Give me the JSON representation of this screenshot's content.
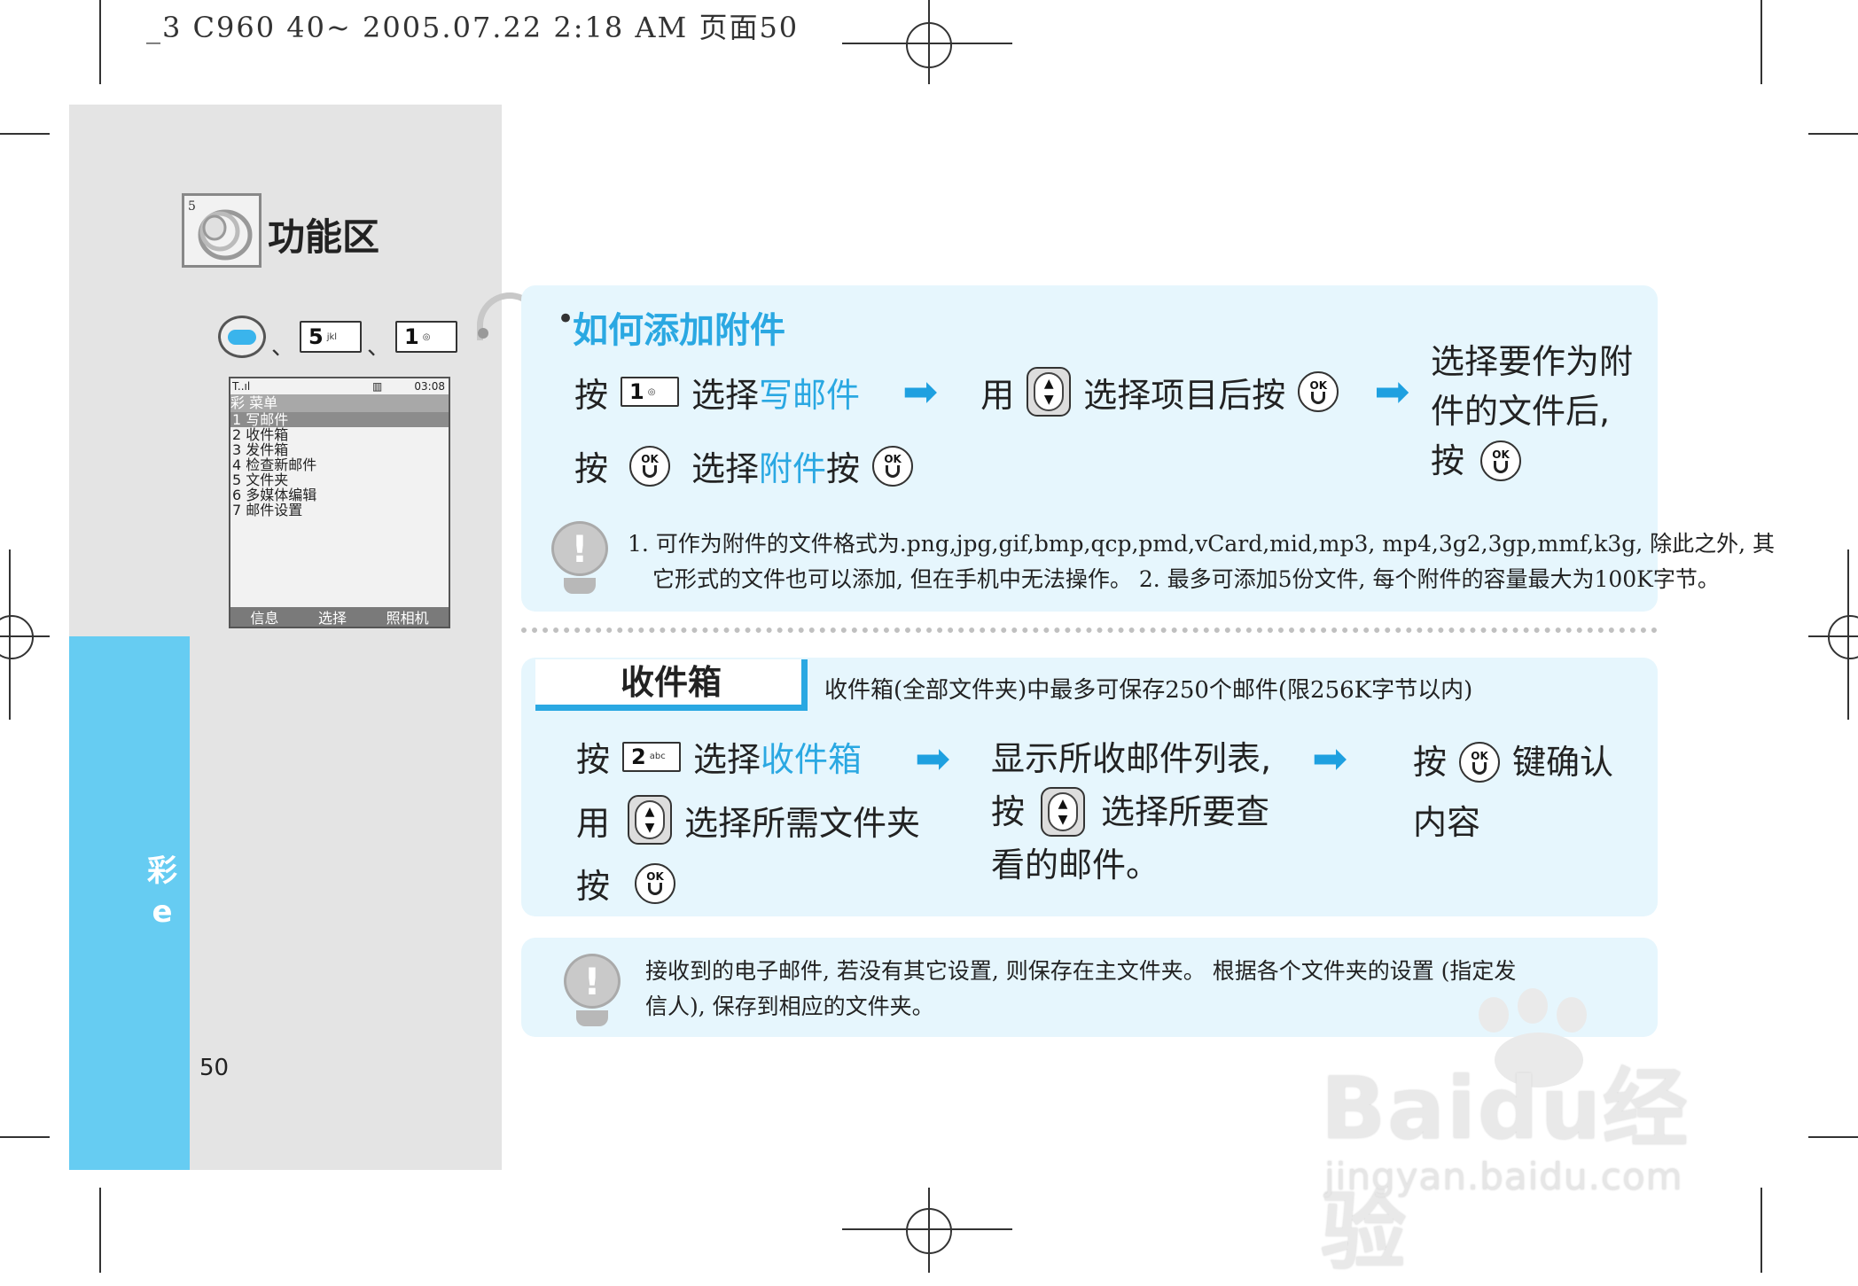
{
  "print_header": "_3 C960 40~ 2005.07.22 2:18 AM 页面50",
  "section": {
    "title": "功能区",
    "side_label": "彩",
    "side_sub": "e",
    "page_number": "50"
  },
  "key_path": {
    "key1_num": "5",
    "key1_letters": "jkl",
    "key2_num": "1",
    "separator": "、"
  },
  "phone_screen": {
    "status_left": "T..ıl",
    "status_right": "03:08",
    "menu_title": "彩 菜单",
    "items": [
      "1 写邮件",
      "2 收件箱",
      "3 发件箱",
      "4 检查新邮件",
      "5 文件夹",
      "6 多媒体编辑",
      "7 邮件设置"
    ],
    "soft_keys": [
      "信息",
      "选择",
      "照相机"
    ]
  },
  "attach": {
    "bullet": "•",
    "title": "如何添加附件",
    "row1": {
      "press": "按",
      "key_num": "1",
      "select": "选择",
      "highlight": "写邮件",
      "use": "用",
      "select_item": "选择项目后按"
    },
    "row2": {
      "press": "按",
      "select": "选择",
      "highlight": "附件",
      "press2": "按"
    },
    "right": {
      "line1": "选择要作为附",
      "line2": "件的文件后,",
      "press": "按"
    },
    "note_line1": "1. 可作为附件的文件格式为.png,jpg,gif,bmp,qcp,pmd,vCard,mid,mp3, mp4,3g2,3gp,mmf,k3g, 除此之外, 其",
    "note_line2": "它形式的文件也可以添加, 但在手机中无法操作。 2. 最多可添加5份文件, 每个附件的容量最大为100K字节。"
  },
  "inbox": {
    "title": "收件箱",
    "subtitle": "收件箱(全部文件夹)中最多可保存250个邮件(限256K字节以内)",
    "col1": {
      "press": "按",
      "key_num": "2",
      "key_letters": "abc",
      "select": "选择",
      "highlight": "收件箱",
      "use": "用",
      "select_folder": "选择所需文件夹",
      "press2": "按"
    },
    "col2": {
      "line1": "显示所收邮件列表,",
      "press": "按",
      "select": "选择所要查",
      "line3": "看的邮件。"
    },
    "col3": {
      "press": "按",
      "confirm": "键确认",
      "line2": "内容"
    }
  },
  "bottom_note": {
    "line1": "接收到的电子邮件, 若没有其它设置, 则保存在主文件夹。 根据各个文件夹的设置 (指定发",
    "line2": "信人), 保存到相应的文件夹。"
  },
  "icons": {
    "ok_label": "OK",
    "arrow": "➡",
    "note": "!",
    "nav_up": "▲",
    "nav_down": "▼"
  },
  "watermark": {
    "logo": "Baidu经验",
    "url": "jingyan.baidu.com"
  },
  "colors": {
    "accent_blue": "#2aa8e2",
    "side_blue": "#66ccf2",
    "box_bg": "#e6f6fd",
    "panel_gray": "#e4e4e4"
  }
}
